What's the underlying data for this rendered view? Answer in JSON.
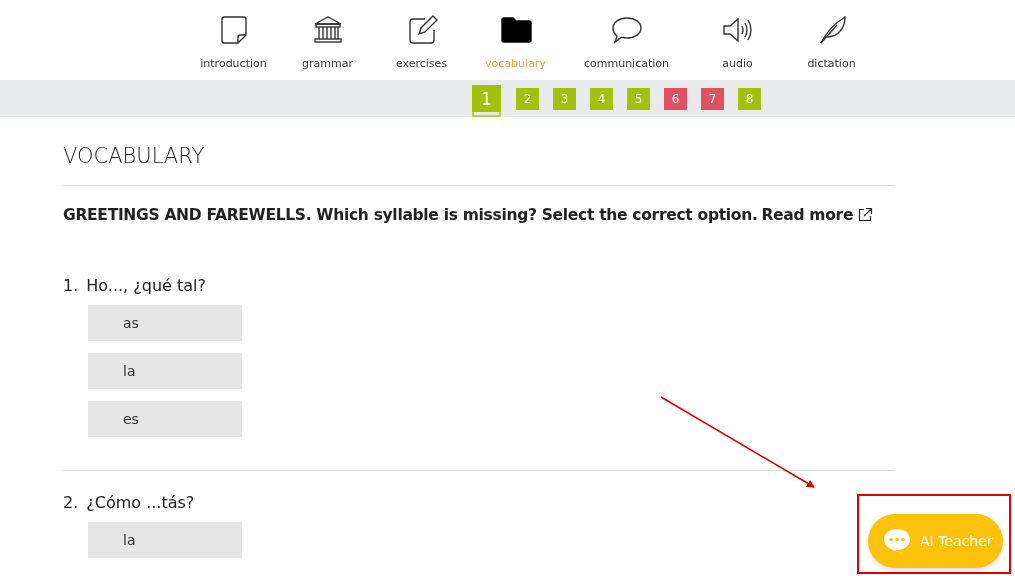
{
  "nav": {
    "tabs": [
      {
        "label": "introduction",
        "selected": false
      },
      {
        "label": "grammar",
        "selected": false
      },
      {
        "label": "exercises",
        "selected": false
      },
      {
        "label": "vocabulary",
        "selected": true
      },
      {
        "label": "communication",
        "selected": false
      },
      {
        "label": "audio",
        "selected": false
      },
      {
        "label": "dictation",
        "selected": false
      }
    ]
  },
  "steps": [
    {
      "label": "1",
      "selected": true,
      "color": "#a3c10b"
    },
    {
      "label": "2",
      "selected": false,
      "color": "#a3c10b"
    },
    {
      "label": "3",
      "selected": false,
      "color": "#a3c10b"
    },
    {
      "label": "4",
      "selected": false,
      "color": "#a3c10b"
    },
    {
      "label": "5",
      "selected": false,
      "color": "#a3c10b"
    },
    {
      "label": "6",
      "selected": false,
      "color": "#e0505f"
    },
    {
      "label": "7",
      "selected": false,
      "color": "#e0505f"
    },
    {
      "label": "8",
      "selected": false,
      "color": "#a3c10b"
    }
  ],
  "section_title": "VOCABULARY",
  "instruction": {
    "text": "GREETINGS AND FAREWELLS. Which syllable is missing? Select the correct option.",
    "link": "Read more"
  },
  "questions": [
    {
      "number": "1.",
      "prompt": "Ho..., ¿qué tal?",
      "options": [
        "as",
        "la",
        "es"
      ]
    },
    {
      "number": "2.",
      "prompt": "¿Cómo ...tás?",
      "options": [
        "la"
      ]
    }
  ],
  "chat_button": {
    "label": "AI Teacher"
  }
}
